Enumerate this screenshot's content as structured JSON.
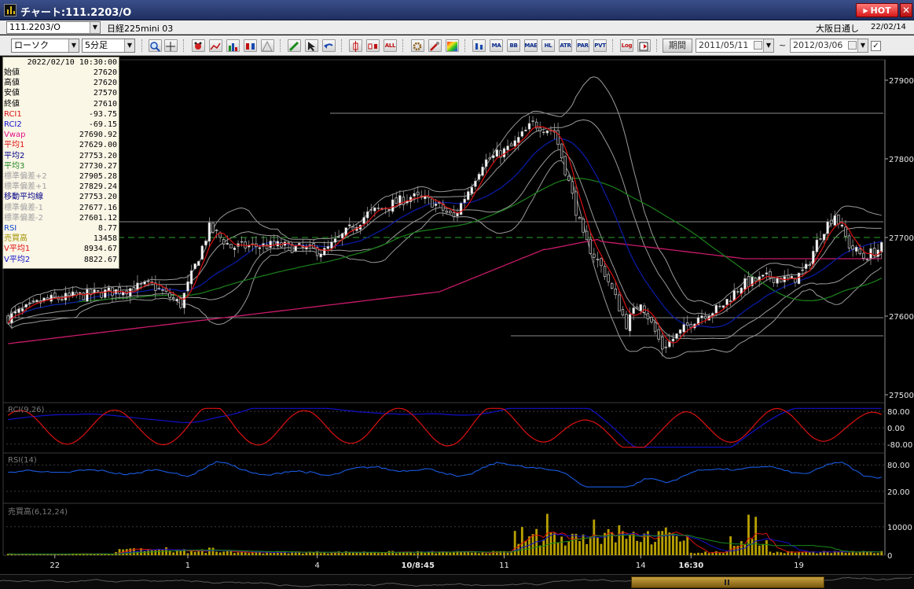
{
  "window": {
    "title": "チャート:111.2203/O",
    "hot_label": "HOT",
    "close_label": "✕"
  },
  "infobar": {
    "symbol": "111.2203/O",
    "instrument": "日経225mini 03",
    "market": "大阪日通し",
    "date": "22/02/14"
  },
  "toolbar": {
    "chart_type": "ローソク",
    "interval": "5分足",
    "text_icons": [
      "ALL",
      "MA",
      "BB",
      "MAE",
      "HL",
      "ATR",
      "PAR",
      "PVT",
      "Log"
    ],
    "period_label": "期間",
    "date_from": "2011/05/11",
    "date_to": "2012/03/06",
    "tilde": "~",
    "check": "✓"
  },
  "data_panel": {
    "datetime": "2022/02/10  10:30:00",
    "rows": [
      {
        "label": "始値",
        "value": "27620",
        "color": "#000000"
      },
      {
        "label": "高値",
        "value": "27620",
        "color": "#000000"
      },
      {
        "label": "安値",
        "value": "27570",
        "color": "#000000"
      },
      {
        "label": "終値",
        "value": "27610",
        "color": "#000000"
      },
      {
        "label": "RCI1",
        "value": "-93.75",
        "color": "#dd1111"
      },
      {
        "label": "RCI2",
        "value": "-69.15",
        "color": "#1111cc"
      },
      {
        "label": "Vwap",
        "value": "27690.92",
        "color": "#dd1188"
      },
      {
        "label": "平均1",
        "value": "27629.00",
        "color": "#dd1111"
      },
      {
        "label": "平均2",
        "value": "27753.20",
        "color": "#000088"
      },
      {
        "label": "平均3",
        "value": "27730.27",
        "color": "#228822"
      },
      {
        "label": "標準偏差+2",
        "value": "27905.28",
        "color": "#a0a0a0"
      },
      {
        "label": "標準偏差+1",
        "value": "27829.24",
        "color": "#a0a0a0"
      },
      {
        "label": "移動平均線",
        "value": "27753.20",
        "color": "#000088"
      },
      {
        "label": "標準偏差-1",
        "value": "27677.16",
        "color": "#a0a0a0"
      },
      {
        "label": "標準偏差-2",
        "value": "27601.12",
        "color": "#a0a0a0"
      },
      {
        "label": "RSI",
        "value": "8.77",
        "color": "#1144cc"
      },
      {
        "label": "売買高",
        "value": "13458",
        "color": "#a09000"
      },
      {
        "label": "V平均1",
        "value": "8934.67",
        "color": "#dd1111"
      },
      {
        "label": "V平均2",
        "value": "8822.67",
        "color": "#1111cc"
      }
    ]
  },
  "chart_data": [
    {
      "type": "candlestick",
      "y_ticks": [
        "27900",
        "27800",
        "27700",
        "27600",
        "27500"
      ],
      "ylim": [
        27500,
        27900
      ],
      "x_labels": [
        "22",
        "1",
        "4",
        "10/8:45",
        "11",
        "14",
        "16:30",
        "19"
      ],
      "reference_line": 27700
    },
    {
      "type": "line",
      "title": "RCI(9,26)",
      "y_ticks": [
        "80.00",
        "0.00",
        "-80.00"
      ],
      "ylim": [
        -100,
        100
      ],
      "series": [
        {
          "name": "RCI1",
          "color": "#dd1111"
        },
        {
          "name": "RCI2",
          "color": "#1111cc"
        }
      ]
    },
    {
      "type": "line",
      "title": "RSI(14)",
      "y_ticks": [
        "80.00",
        "20.00"
      ],
      "ylim": [
        0,
        100
      ],
      "series": [
        {
          "name": "RSI",
          "color": "#1144cc"
        }
      ]
    },
    {
      "type": "bar",
      "title": "売買高(6,12,24)",
      "y_ticks": [
        "10000",
        "0"
      ],
      "ylim": [
        0,
        16000
      ]
    }
  ],
  "colors": {
    "up_candle": "#ffffff",
    "down_candle": "#111111",
    "ma_short": "#dd1111",
    "ma_mid": "#0a1aa0",
    "ma_long": "#1a7a1a",
    "vwap": "#c81a6a",
    "bollinger": "#9a9a9a",
    "volume": "#b8a000"
  }
}
